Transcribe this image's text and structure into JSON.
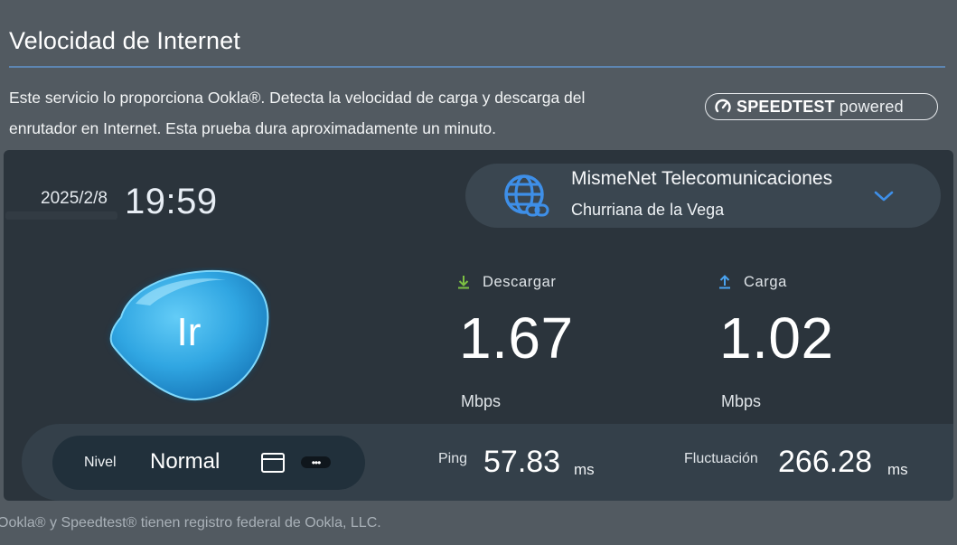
{
  "page": {
    "title": "Velocidad de Internet",
    "description_line1": "Este servicio lo proporciona Ookla®. Detecta la velocidad de carga y descarga del",
    "description_line2": "enrutador en Internet. Esta prueba dura aproximadamente un minuto.",
    "badge_strong": "SPEEDTEST",
    "badge_light": "powered"
  },
  "test": {
    "date": "2025/2/8",
    "time": "19:59",
    "go_label": "Ir"
  },
  "server": {
    "isp": "MismeNet Telecomunicaciones",
    "location": "Churriana de la Vega",
    "icon": "globe-link-icon"
  },
  "download": {
    "label": "Descargar",
    "value": "1.67",
    "unit": "Mbps",
    "icon": "download-arrow-icon",
    "icon_color": "#7cc043"
  },
  "upload": {
    "label": "Carga",
    "value": "1.02",
    "unit": "Mbps",
    "icon": "upload-arrow-icon",
    "icon_color": "#4aa3f0"
  },
  "ping": {
    "label": "Ping",
    "value": "57.83",
    "unit": "ms"
  },
  "jitter": {
    "label": "Fluctuación",
    "value": "266.28",
    "unit": "ms"
  },
  "level": {
    "label": "Nivel",
    "value": "Normal",
    "more_label": "•••"
  },
  "footer": {
    "note": "Ookla® y Speedtest® tienen registro federal de Ookla, LLC."
  },
  "colors": {
    "accent": "#3e8fe8",
    "panel": "#2b343c",
    "background": "#525a61",
    "button": "#3aaee6"
  }
}
